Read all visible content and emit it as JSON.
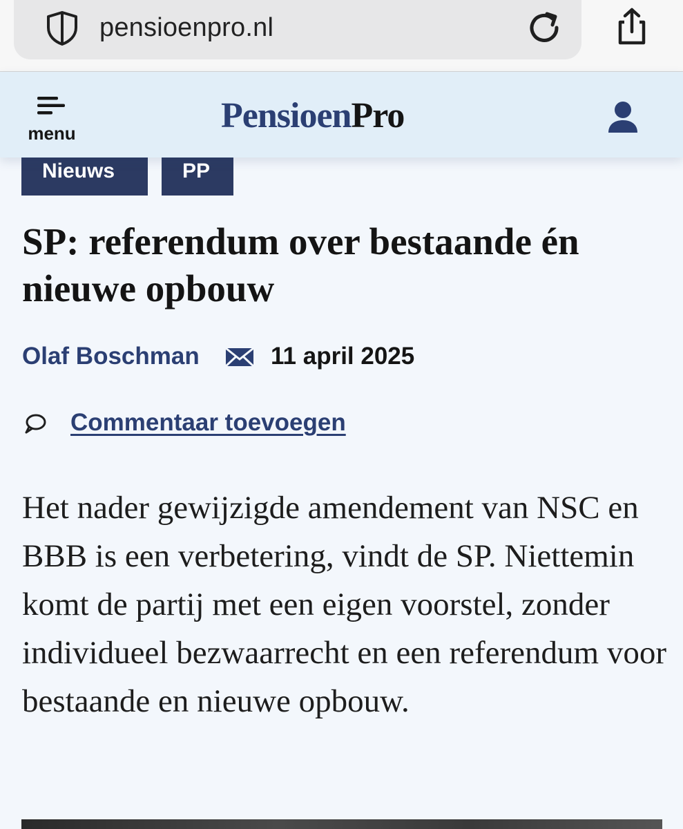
{
  "browser": {
    "url": "pensioenpro.nl"
  },
  "header": {
    "menu_label": "menu",
    "logo_part1": "Pensioen",
    "logo_part2": "Pro"
  },
  "article": {
    "tags": [
      "Nieuws",
      "PP"
    ],
    "title": "SP: referendum over bestaande én nieuwe opbouw",
    "author": "Olaf Boschman",
    "date": "11 april 2025",
    "comment_link": "Commentaar toevoegen",
    "lead": "Het nader gewijzigde amendement van NSC en BBB is een verbetering, vindt de SP. Niettemin komt de partij met een eigen voorstel, zonder individueel bezwaarrecht en een referendum voor bestaande en nieuwe opbouw."
  },
  "colors": {
    "brand_navy": "#2b3f73",
    "tag_bg": "#2c3a62",
    "header_bg": "#e1eef8",
    "page_bg": "#f3f7fc"
  },
  "icons": [
    "shield-icon",
    "reload-icon",
    "share-icon",
    "hamburger-icon",
    "user-icon",
    "mail-icon",
    "comment-icon"
  ]
}
